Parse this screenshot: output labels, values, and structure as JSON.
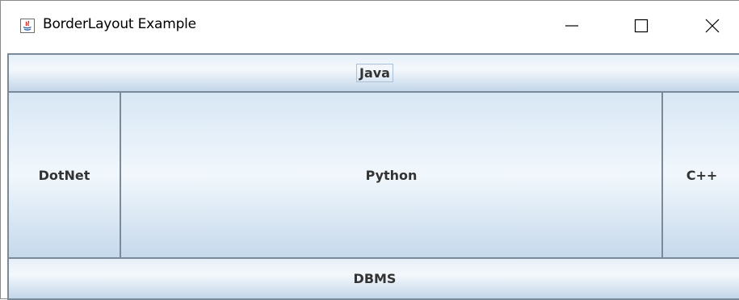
{
  "window": {
    "title": "BorderLayout Example",
    "app_icon": "java-icon",
    "controls": {
      "minimize_icon": "minimize-icon",
      "maximize_icon": "maximize-icon",
      "close_icon": "close-icon"
    }
  },
  "layout": {
    "north_label": "Java",
    "west_label": "DotNet",
    "center_label": "Python",
    "east_label": "C++",
    "south_label": "DBMS"
  },
  "colors": {
    "button_border": "#7a8a99",
    "button_gradient_top": "#d8e7f5",
    "button_gradient_bottom": "#c6d9ec",
    "button_text": "#333333"
  }
}
